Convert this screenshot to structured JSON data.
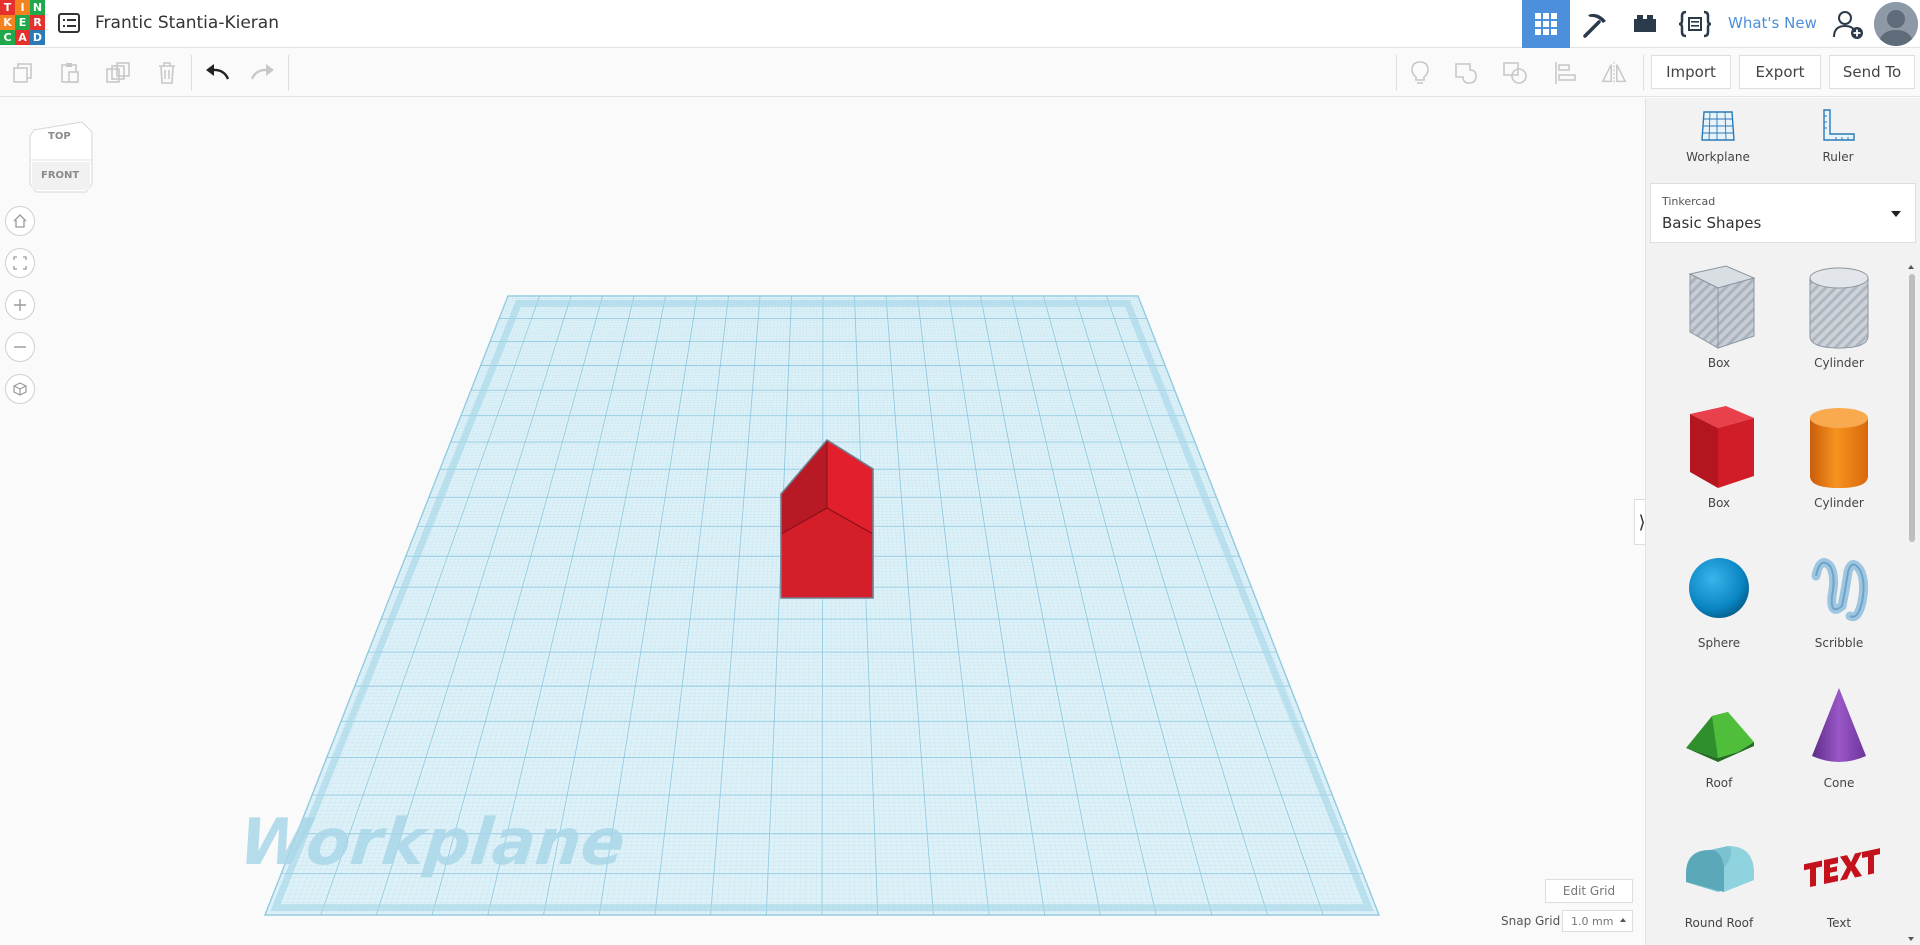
{
  "header": {
    "logo_letters": [
      "T",
      "I",
      "N",
      "K",
      "E",
      "R",
      "C",
      "A",
      "D"
    ],
    "logo_colors": [
      "#e5302b",
      "#f58220",
      "#1fa94a",
      "#f58220",
      "#1fa94a",
      "#e5302b",
      "#1fa94a",
      "#e5302b",
      "#2a7ab8"
    ],
    "project_title": "Frantic Stantia-Kieran",
    "whats_new": "What's New",
    "accent_color": "#4c8fdb",
    "icons": [
      "list-icon",
      "grid-3d-icon",
      "pickaxe-icon",
      "brick-icon",
      "codeblocks-icon",
      "add-user-icon",
      "avatar"
    ]
  },
  "toolbar": {
    "icons": [
      "copy-icon",
      "paste-icon",
      "duplicate-icon",
      "delete-icon",
      "undo-icon",
      "redo-icon",
      "note-icon",
      "group-icon",
      "ungroup-icon",
      "align-icon",
      "mirror-icon"
    ],
    "import_label": "Import",
    "export_label": "Export",
    "send_to_label": "Send To"
  },
  "viewcube": {
    "top_label": "TOP",
    "front_label": "FRONT"
  },
  "nav": {
    "icons": [
      "home-icon",
      "fit-icon",
      "zoom-in-icon",
      "zoom-out-icon",
      "perspective-icon"
    ]
  },
  "workplane": {
    "watermark": "Workplane",
    "grid_color": "#bfe3f0",
    "shape_color": "#d91f2b"
  },
  "grid_controls": {
    "edit_grid_label": "Edit Grid",
    "snap_grid_label": "Snap Grid",
    "snap_value": "1.0 mm"
  },
  "panel": {
    "workplane_label": "Workplane",
    "ruler_label": "Ruler",
    "library_source": "Tinkercad",
    "library_name": "Basic Shapes",
    "shapes": [
      {
        "label": "Box",
        "kind": "hole-box"
      },
      {
        "label": "Cylinder",
        "kind": "hole-cylinder"
      },
      {
        "label": "Box",
        "kind": "box"
      },
      {
        "label": "Cylinder",
        "kind": "cylinder"
      },
      {
        "label": "Sphere",
        "kind": "sphere"
      },
      {
        "label": "Scribble",
        "kind": "scribble"
      },
      {
        "label": "Roof",
        "kind": "roof"
      },
      {
        "label": "Cone",
        "kind": "cone"
      },
      {
        "label": "Round Roof",
        "kind": "round-roof"
      },
      {
        "label": "Text",
        "kind": "text"
      }
    ]
  }
}
